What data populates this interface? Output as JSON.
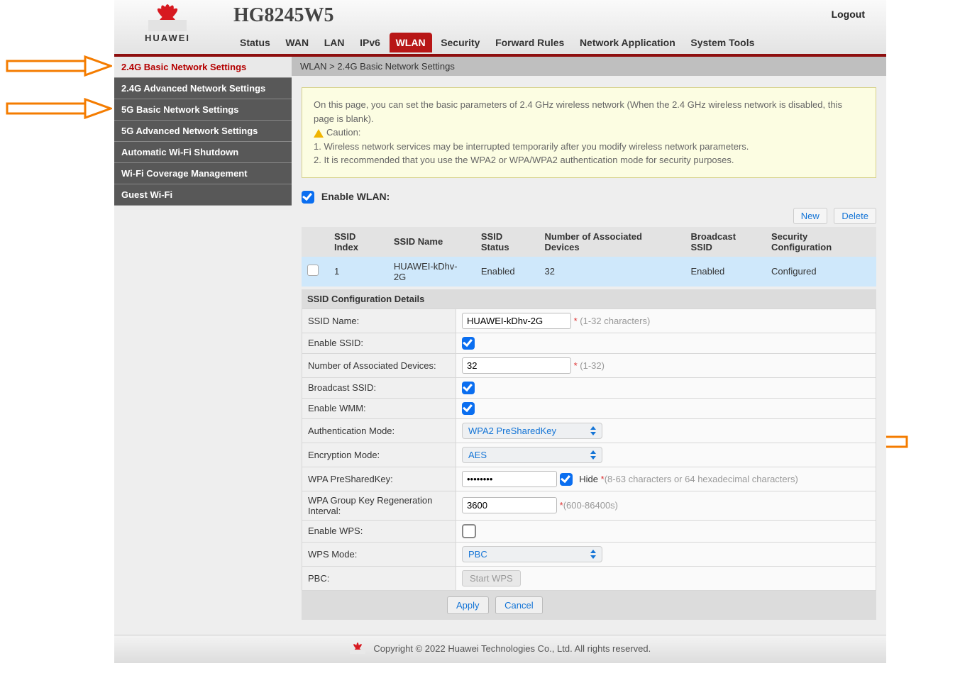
{
  "header": {
    "brand": "HUAWEI",
    "model": "HG8245W5",
    "logout": "Logout",
    "nav": [
      "Status",
      "WAN",
      "LAN",
      "IPv6",
      "WLAN",
      "Security",
      "Forward Rules",
      "Network Application",
      "System Tools"
    ],
    "nav_active_index": 4
  },
  "sidebar": {
    "items": [
      "2.4G Basic Network Settings",
      "2.4G Advanced Network Settings",
      "5G Basic Network Settings",
      "5G Advanced Network Settings",
      "Automatic Wi-Fi Shutdown",
      "Wi-Fi Coverage Management",
      "Guest Wi-Fi"
    ],
    "active_index": 0
  },
  "breadcrumb": "WLAN > 2.4G Basic Network Settings",
  "notice": {
    "intro": "On this page, you can set the basic parameters of 2.4 GHz wireless network (When the 2.4 GHz wireless network is disabled, this page is blank).",
    "caution_label": "Caution:",
    "line1": "1. Wireless network services may be interrupted temporarily after you modify wireless network parameters.",
    "line2": "2. It is recommended that you use the WPA2 or WPA/WPA2 authentication mode for security purposes."
  },
  "enable_wlan_label": "Enable WLAN:",
  "toolbar": {
    "new": "New",
    "delete": "Delete"
  },
  "table": {
    "headers": [
      "SSID Index",
      "SSID Name",
      "SSID Status",
      "Number of Associated Devices",
      "Broadcast SSID",
      "Security Configuration"
    ],
    "row": {
      "index": "1",
      "name": "HUAWEI-kDhv-2G",
      "status": "Enabled",
      "devices": "32",
      "broadcast": "Enabled",
      "security": "Configured"
    }
  },
  "section_title": "SSID Configuration Details",
  "form": {
    "ssid_name": {
      "label": "SSID Name:",
      "value": "HUAWEI-kDhv-2G",
      "hint": "(1-32 characters)"
    },
    "enable_ssid": {
      "label": "Enable SSID:"
    },
    "num_devices": {
      "label": "Number of Associated Devices:",
      "value": "32",
      "hint": "(1-32)"
    },
    "broadcast_ssid": {
      "label": "Broadcast SSID:"
    },
    "enable_wmm": {
      "label": "Enable WMM:"
    },
    "auth_mode": {
      "label": "Authentication Mode:",
      "value": "WPA2 PreSharedKey"
    },
    "enc_mode": {
      "label": "Encryption Mode:",
      "value": "AES"
    },
    "psk": {
      "label": "WPA PreSharedKey:",
      "value": "••••••••",
      "hide_label": "Hide",
      "hint": "(8-63 characters or 64 hexadecimal characters)"
    },
    "group_key": {
      "label": "WPA Group Key Regeneration Interval:",
      "value": "3600",
      "hint": "(600-86400s)"
    },
    "enable_wps": {
      "label": "Enable WPS:"
    },
    "wps_mode": {
      "label": "WPS Mode:",
      "value": "PBC"
    },
    "pbc": {
      "label": "PBC:",
      "button": "Start WPS"
    }
  },
  "buttons": {
    "apply": "Apply",
    "cancel": "Cancel"
  },
  "footer": "Copyright © 2022 Huawei Technologies Co., Ltd. All rights reserved."
}
